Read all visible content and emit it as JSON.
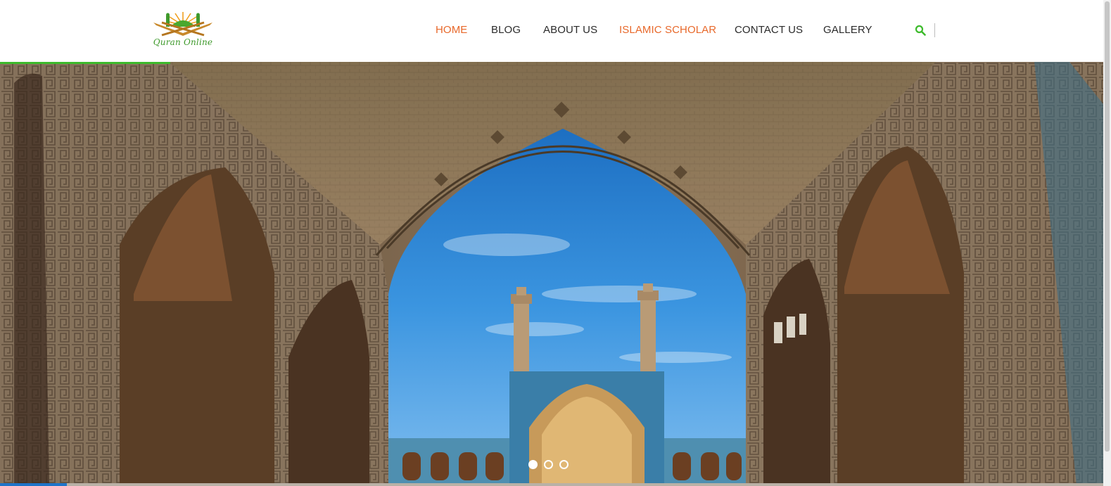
{
  "logo": {
    "text": "Quran Online",
    "icon": "quran-book-sunburst-logo"
  },
  "nav": {
    "items": [
      {
        "label": "HOME",
        "active": true
      },
      {
        "label": "BLOG",
        "active": false
      },
      {
        "label": "ABOUT US",
        "active": false
      },
      {
        "label": "ISLAMIC SCHOLAR",
        "active": true
      },
      {
        "label": "CONTACT US",
        "active": false
      },
      {
        "label": "GALLERY",
        "active": false
      }
    ],
    "search_icon": "search-icon"
  },
  "hero": {
    "image": "mosque-arch-courtyard-photo",
    "slides": {
      "count": 3,
      "active_index": 0
    }
  },
  "colors": {
    "active_nav": "#e8692b",
    "nav_text": "#2b2b2b",
    "brand_green": "#3dbb2c",
    "sky_blue": "#2f86d6",
    "stone": "#7a6550"
  }
}
